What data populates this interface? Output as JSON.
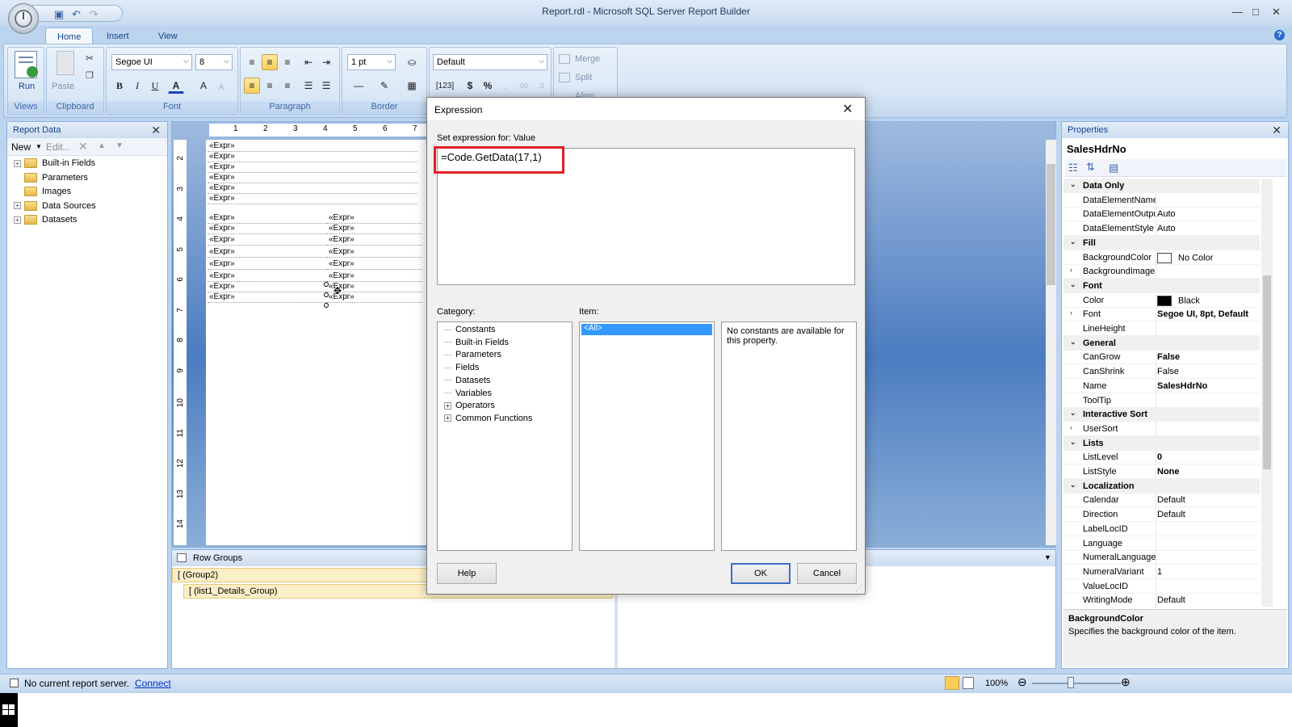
{
  "window": {
    "title": "Report.rdl - Microsoft SQL Server Report Builder",
    "minimize_glyph": "—",
    "maximize_glyph": "□",
    "close_glyph": "✕",
    "help_glyph": "?"
  },
  "qat": {
    "save_glyph": "💾",
    "undo_glyph": "↶",
    "redo_glyph": "↷"
  },
  "ribbon": {
    "tabs": [
      "Home",
      "Insert",
      "View"
    ],
    "groups": {
      "views": {
        "label": "Views",
        "run_label": "Run"
      },
      "clipboard": {
        "label": "Clipboard",
        "paste_label": "Paste"
      },
      "font": {
        "label": "Font",
        "family": "Segoe UI",
        "size": "8",
        "bold": "B",
        "italic": "I",
        "underline": "U",
        "color": "A",
        "grow": "A",
        "shrink": "A"
      },
      "paragraph": {
        "label": "Paragraph"
      },
      "border": {
        "label": "Border",
        "width": "1 pt"
      },
      "number": {
        "format": "Default",
        "currency": "$",
        "percent": "%",
        "comma": ","
      },
      "layout": {
        "merge": "Merge",
        "split": "Split",
        "align": "Align"
      }
    }
  },
  "report_data": {
    "title": "Report Data",
    "close_glyph": "✕",
    "toolbar": {
      "new": "New",
      "edit": "Edit..."
    },
    "tree": [
      {
        "label": "Built-in Fields",
        "expandable": "+"
      },
      {
        "label": "Parameters",
        "expandable": ""
      },
      {
        "label": "Images",
        "expandable": ""
      },
      {
        "label": "Data Sources",
        "expandable": "+"
      },
      {
        "label": "Datasets",
        "expandable": "+"
      }
    ]
  },
  "design": {
    "ruler_top": [
      "1",
      "2",
      "3",
      "4",
      "5",
      "6",
      "7"
    ],
    "ruler_left": [
      "2",
      "3",
      "4",
      "5",
      "6",
      "7",
      "8",
      "9",
      "10",
      "11",
      "12",
      "13",
      "14"
    ],
    "expr_text": "«Expr»"
  },
  "row_groups": {
    "title": "Row Groups",
    "items": [
      "(Group2)",
      "(list1_Details_Group)"
    ],
    "bracket": "["
  },
  "properties": {
    "title": "Properties",
    "close_glyph": "✕",
    "selected": "SalesHdrNo",
    "rows": [
      {
        "type": "cat",
        "name": "Data Only"
      },
      {
        "type": "item",
        "name": "DataElementName",
        "value": ""
      },
      {
        "type": "item",
        "name": "DataElementOutput",
        "value": "Auto"
      },
      {
        "type": "item",
        "name": "DataElementStyle",
        "value": "Auto"
      },
      {
        "type": "cat",
        "name": "Fill"
      },
      {
        "type": "item",
        "name": "BackgroundColor",
        "value": "No Color",
        "swatch": "#ffffff"
      },
      {
        "type": "item",
        "name": "BackgroundImage",
        "value": "",
        "expand": "›"
      },
      {
        "type": "cat",
        "name": "Font"
      },
      {
        "type": "item",
        "name": "Color",
        "value": "Black",
        "swatch": "#000000"
      },
      {
        "type": "item",
        "name": "Font",
        "value": "Segoe UI, 8pt, Default",
        "expand": "›",
        "bold": true
      },
      {
        "type": "item",
        "name": "LineHeight",
        "value": ""
      },
      {
        "type": "cat",
        "name": "General"
      },
      {
        "type": "item",
        "name": "CanGrow",
        "value": "False",
        "bold": true
      },
      {
        "type": "item",
        "name": "CanShrink",
        "value": "False"
      },
      {
        "type": "item",
        "name": "Name",
        "value": "SalesHdrNo",
        "bold": true
      },
      {
        "type": "item",
        "name": "ToolTip",
        "value": ""
      },
      {
        "type": "cat",
        "name": "Interactive Sort"
      },
      {
        "type": "item",
        "name": "UserSort",
        "value": "",
        "expand": "›"
      },
      {
        "type": "cat",
        "name": "Lists"
      },
      {
        "type": "item",
        "name": "ListLevel",
        "value": "0",
        "bold": true
      },
      {
        "type": "item",
        "name": "ListStyle",
        "value": "None",
        "bold": true
      },
      {
        "type": "cat",
        "name": "Localization"
      },
      {
        "type": "item",
        "name": "Calendar",
        "value": "Default"
      },
      {
        "type": "item",
        "name": "Direction",
        "value": "Default"
      },
      {
        "type": "item",
        "name": "LabelLocID",
        "value": ""
      },
      {
        "type": "item",
        "name": "Language",
        "value": ""
      },
      {
        "type": "item",
        "name": "NumeralLanguage",
        "value": ""
      },
      {
        "type": "item",
        "name": "NumeralVariant",
        "value": "1"
      },
      {
        "type": "item",
        "name": "ValueLocID",
        "value": ""
      },
      {
        "type": "item",
        "name": "WritingMode",
        "value": "Default"
      }
    ],
    "description": {
      "title": "BackgroundColor",
      "text": "Specifies the background color of the item."
    }
  },
  "status": {
    "text": "No current report server.",
    "link": "Connect",
    "zoom": "100%"
  },
  "dialog": {
    "title": "Expression",
    "close_glyph": "✕",
    "set_label": "Set expression for: Value",
    "expression": "=Code.GetData(17,1)",
    "category_label": "Category:",
    "item_label": "Item:",
    "categories": [
      {
        "label": "Constants",
        "expandable": ""
      },
      {
        "label": "Built-in Fields",
        "expandable": ""
      },
      {
        "label": "Parameters",
        "expandable": ""
      },
      {
        "label": "Fields",
        "expandable": ""
      },
      {
        "label": "Datasets",
        "expandable": ""
      },
      {
        "label": "Variables",
        "expandable": ""
      },
      {
        "label": "Operators",
        "expandable": "+"
      },
      {
        "label": "Common Functions",
        "expandable": "+"
      }
    ],
    "item_selected": "<All>",
    "description": "No constants are available for this property.",
    "buttons": {
      "help": "Help",
      "ok": "OK",
      "cancel": "Cancel"
    }
  },
  "colors": {
    "highlight": "#e0202a",
    "selection": "#3399ff",
    "accent": "#15428b"
  }
}
